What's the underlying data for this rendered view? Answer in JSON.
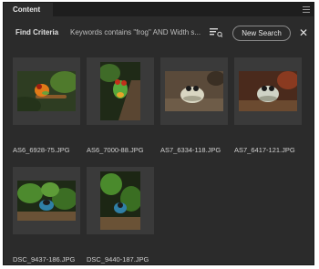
{
  "panel": {
    "tab_title": "Content"
  },
  "criteria": {
    "label": "Find Criteria",
    "text": "Keywords contains \"frog\" AND Width s...",
    "new_search_label": "New Search",
    "close_glyph": "✕",
    "filter_icon": "filter-list-icon"
  },
  "items": [
    {
      "filename": "AS6_6928-75.JPG"
    },
    {
      "filename": "AS6_7000-88.JPG"
    },
    {
      "filename": "AS7_6334-118.JPG"
    },
    {
      "filename": "AS7_6417-121.JPG"
    },
    {
      "filename": "DSC_9437-186.JPG"
    },
    {
      "filename": "DSC_9440-187.JPG"
    }
  ],
  "colors": {
    "panel_bg": "#2b2b2b",
    "thumb_bg": "#3a3a3a",
    "text": "#e0e0e0"
  }
}
